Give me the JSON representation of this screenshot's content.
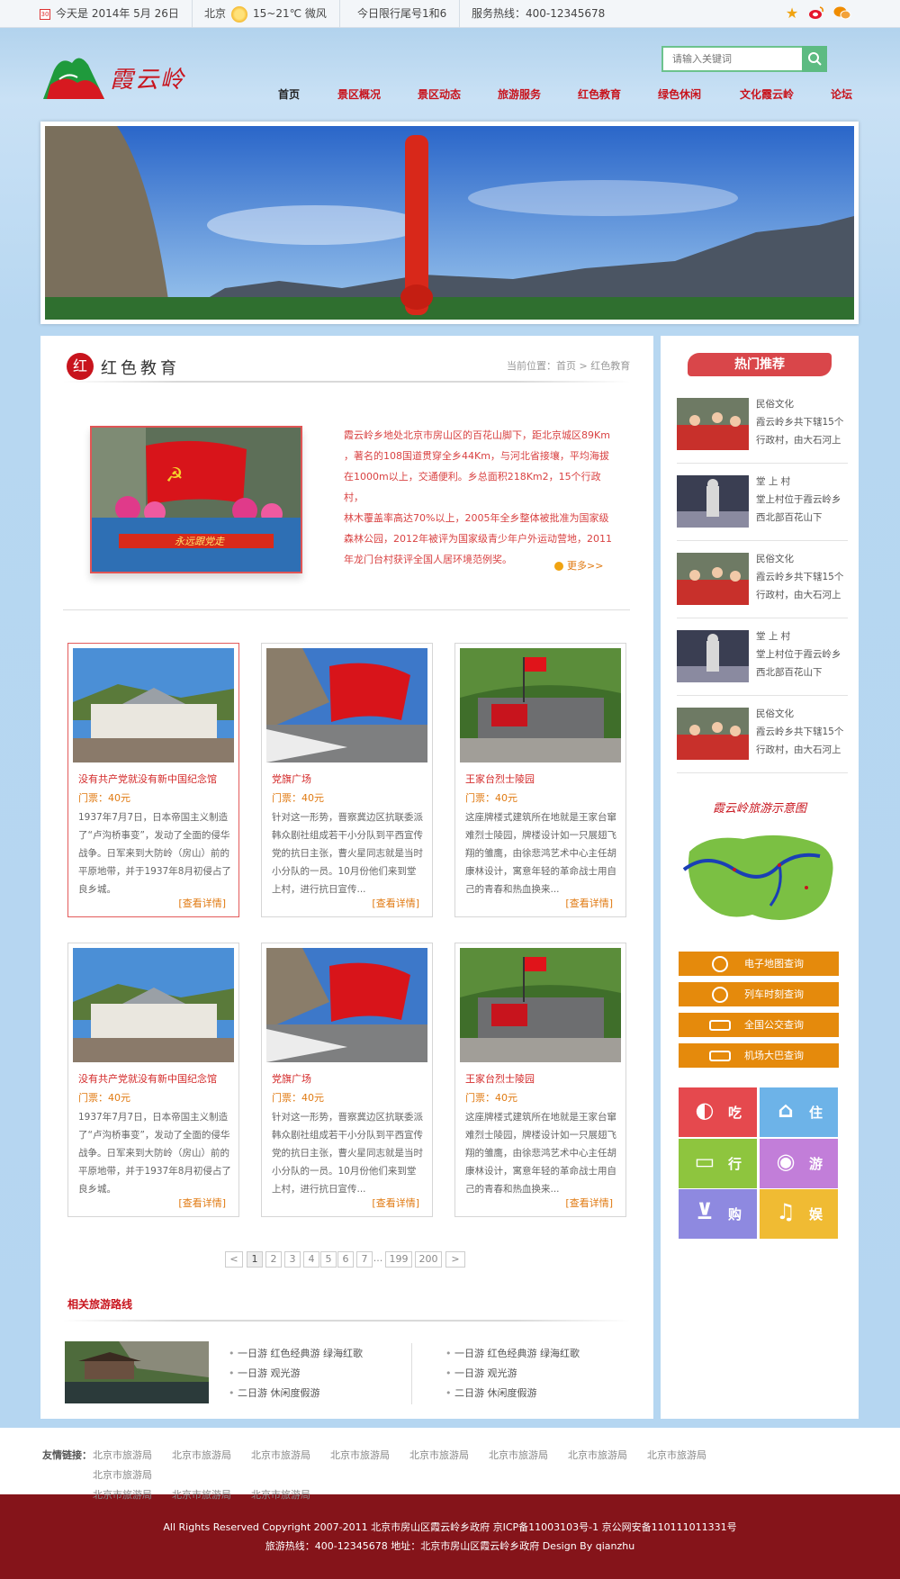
{
  "topbar": {
    "date": "今天是 2014年 5月 26日",
    "city": "北京",
    "weather": "15~21℃ 微风",
    "restriction": "今日限行尾号1和6",
    "hotline": "服务热线：400-12345678",
    "icons": [
      "star-icon",
      "weibo-icon",
      "wechat-icon"
    ]
  },
  "header": {
    "logo_text": "霞云岭",
    "search_placeholder": "请输入关键词",
    "nav": [
      "首页",
      "景区概况",
      "景区动态",
      "旅游服务",
      "红色教育",
      "绿色休闲",
      "文化霞云岭",
      "论坛"
    ]
  },
  "main": {
    "section_title": "红色教育",
    "breadcrumb": "当前位置：首页 > 红色教育",
    "intro_lines": [
      "霞云岭乡地处北京市房山区的百花山脚下，距北京城区89Km",
      "，著名的108国道贯穿全乡44Km，与河北省接壤，平均海拔",
      "在1000m以上，交通便利。乡总面积218Km2，15个行政村，",
      "林木覆盖率高达70%以上，2005年全乡整体被批准为国家级",
      "森林公园，2012年被评为国家级青少年户外运动营地，2011",
      "年龙门台村获评全国人居环境范例奖。"
    ],
    "intro_more": "更多>>",
    "intro_banner_text": "永远跟党走",
    "cards": [
      {
        "title": "没有共产党就没有新中国纪念馆",
        "price": "门票：40元",
        "desc": "1937年7月7日，日本帝国主义制造了“卢沟桥事变”，发动了全面的侵华战争。日军来到大防岭（房山）前的平原地带，并于1937年8月初侵占了良乡城。",
        "more": "[查看详情]"
      },
      {
        "title": "党旗广场",
        "price": "门票：40元",
        "desc": "针对这一形势，晋察冀边区抗联委派韩众剧社组成若干小分队到平西宣传党的抗日主张，曹火星同志就是当时小分队的一员。10月份他们来到堂上村，进行抗日宣传...",
        "more": "[查看详情]"
      },
      {
        "title": "王家台烈士陵园",
        "price": "门票：40元",
        "desc": "这座牌楼式建筑所在地就是王家台窜难烈士陵园，牌楼设计如一只展翅飞翔的雏鹰，由徐悲鸿艺术中心主任胡康林设计，寓意年轻的革命战士用自己的青春和热血换来...",
        "more": "[查看详情]"
      },
      {
        "title": "没有共产党就没有新中国纪念馆",
        "price": "门票：40元",
        "desc": "1937年7月7日，日本帝国主义制造了“卢沟桥事变”，发动了全面的侵华战争。日军来到大防岭（房山）前的平原地带，并于1937年8月初侵占了良乡城。",
        "more": "[查看详情]"
      },
      {
        "title": "党旗广场",
        "price": "门票：40元",
        "desc": "针对这一形势，晋察冀边区抗联委派韩众剧社组成若干小分队到平西宣传党的抗日主张，曹火星同志就是当时小分队的一员。10月份他们来到堂上村，进行抗日宣传...",
        "more": "[查看详情]"
      },
      {
        "title": "王家台烈士陵园",
        "price": "门票：40元",
        "desc": "这座牌楼式建筑所在地就是王家台窜难烈士陵园，牌楼设计如一只展翅飞翔的雏鹰，由徐悲鸿艺术中心主任胡康林设计，寓意年轻的革命战士用自己的青春和热血换来...",
        "more": "[查看详情]"
      }
    ],
    "pagination": [
      "<",
      "1",
      "2",
      "3",
      "4",
      "5",
      "6",
      "7",
      "...",
      "199",
      "200",
      ">"
    ],
    "routes_title": "相关旅游路线",
    "routes_left": [
      "一日游 红色经典游  绿海红歌",
      "一日游 观光游",
      "二日游  休闲度假游"
    ],
    "routes_right": [
      "一日游 红色经典游  绿海红歌",
      "一日游 观光游",
      "二日游  休闲度假游"
    ]
  },
  "side": {
    "hot_title": "热门推荐",
    "hot_items": [
      {
        "cat": "民俗文化",
        "l1": "霞云岭乡共下辖15个",
        "l2": "行政村，由大石河上"
      },
      {
        "cat": "堂 上 村",
        "l1": "堂上村位于霞云岭乡",
        "l2": "西北部百花山下"
      },
      {
        "cat": "民俗文化",
        "l1": "霞云岭乡共下辖15个",
        "l2": "行政村，由大石河上"
      },
      {
        "cat": "堂 上 村",
        "l1": "堂上村位于霞云岭乡",
        "l2": "西北部百花山下"
      },
      {
        "cat": "民俗文化",
        "l1": "霞云岭乡共下辖15个",
        "l2": "行政村，由大石河上"
      }
    ],
    "map_title": "霞云岭旅游示意图",
    "buttons": [
      "电子地图查询",
      "列车时刻查询",
      "全国公交查询",
      "机场大巴查询"
    ],
    "tiles": [
      {
        "label": "吃",
        "color": "#e5494e",
        "icon": "apple-icon"
      },
      {
        "label": "住",
        "color": "#6db3e8",
        "icon": "house-icon"
      },
      {
        "label": "行",
        "color": "#8ec53e",
        "icon": "car-icon"
      },
      {
        "label": "游",
        "color": "#c27ed9",
        "icon": "camera-icon"
      },
      {
        "label": "购",
        "color": "#8e89e0",
        "icon": "cart-icon"
      },
      {
        "label": "娱",
        "color": "#f0bb33",
        "icon": "music-icon"
      }
    ]
  },
  "footer": {
    "friends_label": "友情链接：",
    "friends": [
      "北京市旅游局",
      "北京市旅游局",
      "北京市旅游局",
      "北京市旅游局",
      "北京市旅游局",
      "北京市旅游局",
      "北京市旅游局",
      "北京市旅游局",
      "北京市旅游局",
      "北京市旅游局",
      "北京市旅游局",
      "北京市旅游局"
    ],
    "copyright": "All Rights Reserved Copyright 2007-2011  北京市房山区霞云岭乡政府   京ICP备11003103号-1   京公网安备110111011331号",
    "contact": "旅游热线：400-12345678   地址：北京市房山区霞云岭乡政府   Design By qianzhu"
  }
}
